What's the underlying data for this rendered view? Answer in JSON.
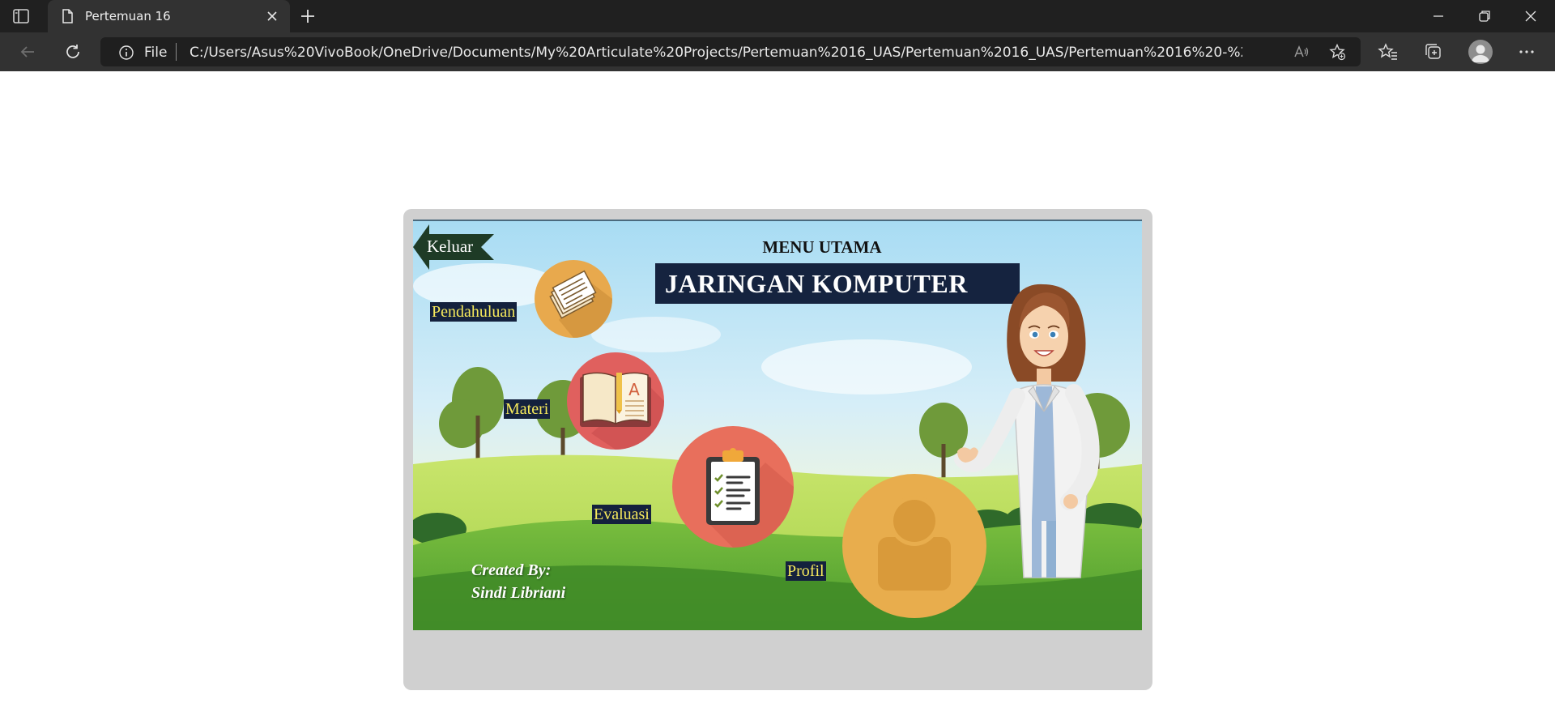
{
  "browser": {
    "tab_title": "Pertemuan 16",
    "address_scheme": "File",
    "url": "C:/Users/Asus%20VivoBook/OneDrive/Documents/My%20Articulate%20Projects/Pertemuan%2016_UAS/Pertemuan%2016_UAS/Pertemuan%2016%20-%20Storyline%20outp..."
  },
  "slide": {
    "exit_label": "Keluar",
    "menu_heading": "MENU UTAMA",
    "title": "JARINGAN KOMPUTER",
    "menu": {
      "pendahuluan": "Pendahuluan",
      "materi": "Materi",
      "evaluasi": "Evaluasi",
      "profil": "Profil"
    },
    "credit_line1": "Created By:",
    "credit_line2": "Sindi Libriani"
  },
  "colors": {
    "chrome_dark": "#202020",
    "chrome_mid": "#323232",
    "label_bg": "#14213d",
    "label_text": "#f7ea5c",
    "orange": "#e8a94d",
    "red": "#e0605e",
    "coral": "#e86f5c",
    "exit_green": "#1e3b26"
  },
  "icons": [
    "sidebar-toggle-icon",
    "page-icon",
    "close-icon",
    "plus-icon",
    "minimize-icon",
    "restore-icon",
    "window-close-icon",
    "back-icon",
    "refresh-icon",
    "info-icon",
    "read-aloud-icon",
    "add-favorite-icon",
    "favorites-icon",
    "collections-icon",
    "profile-icon",
    "more-icon",
    "newspaper-icon",
    "book-icon",
    "clipboard-icon",
    "user-icon"
  ]
}
